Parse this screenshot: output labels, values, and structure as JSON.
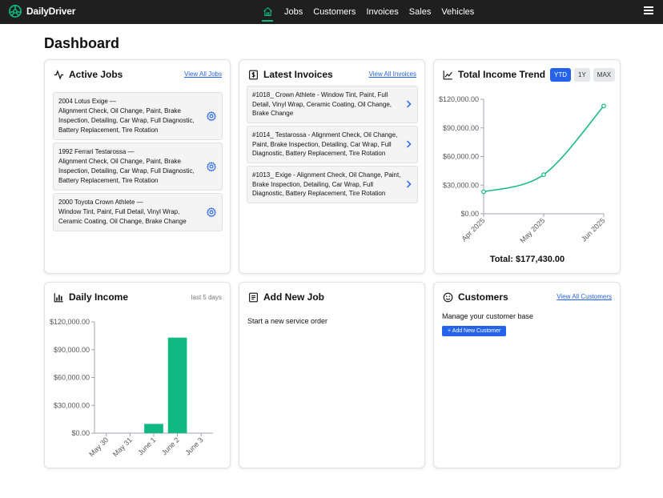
{
  "app": {
    "name": "DailyDriver"
  },
  "nav": {
    "items": [
      "Jobs",
      "Customers",
      "Invoices",
      "Sales",
      "Vehicles"
    ]
  },
  "page": {
    "title": "Dashboard"
  },
  "active_jobs": {
    "title": "Active Jobs",
    "link": "View All Jobs",
    "items": [
      {
        "vehicle": "2004 Lotus Exige —",
        "services": "Alignment Check, Oil Change, Paint, Brake Inspection, Detailing, Car Wrap, Full Diagnostic, Battery Replacement, Tire Rotation"
      },
      {
        "vehicle": "1992 Ferrari Testarossa —",
        "services": "Alignment Check, Oil Change, Paint, Brake Inspection, Detailing, Car Wrap, Full Diagnostic, Battery Replacement, Tire Rotation"
      },
      {
        "vehicle": "2000 Toyota Crown Athlete —",
        "services": "Window Tint, Paint, Full Detail, Vinyl Wrap, Ceramic Coating, Oil Change, Brake Change"
      }
    ]
  },
  "latest_invoices": {
    "title": "Latest Invoices",
    "link": "View All Invoices",
    "items": [
      "#1018_ Crown Athlete - Window Tint, Paint, Full Detail, Vinyl Wrap, Ceramic Coating, Oil Change, Brake Change",
      "#1014_ Testarossa - Alignment Check, Oil Change, Paint, Brake Inspection, Detailing, Car Wrap, Full Diagnostic, Battery Replacement, Tire Rotation",
      "#1013_ Exige - Alignment Check, Oil Change, Paint, Brake Inspection, Detailing, Car Wrap, Full Diagnostic, Battery Replacement, Tire Rotation"
    ]
  },
  "income_trend": {
    "title": "Total Income Trend",
    "ranges": [
      "YTD",
      "1Y",
      "MAX"
    ],
    "active_range": "YTD",
    "total": "Total: $177,430.00",
    "color": "#10b981"
  },
  "daily_income": {
    "title": "Daily Income",
    "note": "last 5 days",
    "color": "#10b981"
  },
  "add_job": {
    "title": "Add New Job",
    "subtitle": "Start a new service order"
  },
  "customers": {
    "title": "Customers",
    "link": "View All Customers",
    "subtitle": "Manage your customer base",
    "button": "+ Add New Customer"
  },
  "chart_data": [
    {
      "type": "line",
      "x": [
        "Apr 2025",
        "May 2025",
        "Jun 2025"
      ],
      "values": [
        23000,
        41000,
        113000
      ],
      "yticks": [
        "$0.00",
        "$30,000.00",
        "$60,000.00",
        "$90,000.00",
        "$120,000.00"
      ],
      "ylim": [
        0,
        120000
      ],
      "grid": false,
      "color": "#10b981"
    },
    {
      "type": "bar",
      "categories": [
        "May 30",
        "May 31",
        "June 1",
        "June 2",
        "June 3"
      ],
      "values": [
        0,
        0,
        10000,
        103000,
        0
      ],
      "yticks": [
        "$0.00",
        "$30,000.00",
        "$60,000.00",
        "$90,000.00",
        "$120,000.00"
      ],
      "ylim": [
        0,
        120000
      ],
      "grid": false,
      "color": "#10b981"
    }
  ]
}
